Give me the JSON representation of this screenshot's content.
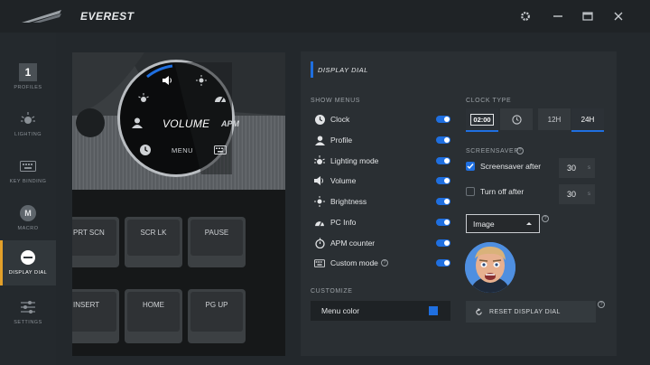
{
  "app": {
    "title": "EVEREST"
  },
  "sidebar": {
    "items": [
      {
        "label": "PROFILES",
        "badge": "1"
      },
      {
        "label": "LIGHTING"
      },
      {
        "label": "KEY BINDING"
      },
      {
        "label": "MACRO",
        "badge": "M"
      },
      {
        "label": "DISPLAY DIAL",
        "active": true
      },
      {
        "label": "SETTINGS"
      }
    ]
  },
  "preview": {
    "dial": {
      "center_label": "VOLUME",
      "apm_label": "APM",
      "menu_label": "MENU"
    },
    "keys": [
      "PRT SCN",
      "SCR LK",
      "PAUSE",
      "INSERT",
      "HOME",
      "PG UP"
    ]
  },
  "panel": {
    "title": "DISPLAY DIAL",
    "show_menus_label": "SHOW MENUS",
    "menus": [
      {
        "label": "Clock",
        "icon": "clock-icon",
        "enabled": true
      },
      {
        "label": "Profile",
        "icon": "profile-icon",
        "enabled": true
      },
      {
        "label": "Lighting mode",
        "icon": "lighting-icon",
        "enabled": true
      },
      {
        "label": "Volume",
        "icon": "volume-icon",
        "enabled": true
      },
      {
        "label": "Brightness",
        "icon": "brightness-icon",
        "enabled": true
      },
      {
        "label": "PC Info",
        "icon": "gauge-icon",
        "enabled": true
      },
      {
        "label": "APM counter",
        "icon": "stopwatch-icon",
        "enabled": true
      },
      {
        "label": "Custom mode",
        "icon": "keyboard-icon",
        "enabled": true
      }
    ],
    "customize_label": "CUSTOMIZE",
    "menu_color_label": "Menu color",
    "menu_color": "#1f6fe0",
    "clock_type_label": "CLOCK TYPE",
    "clock_digital": "02:00",
    "clock_12h": "12H",
    "clock_24h": "24H",
    "screensaver_label": "SCREENSAVER",
    "screensaver_after_label": "Screensaver after",
    "screensaver_after_value": "30",
    "screensaver_after_checked": true,
    "turn_off_after_label": "Turn off after",
    "turn_off_after_value": "30",
    "turn_off_after_checked": false,
    "unit": "s",
    "image_select": "Image",
    "reset_label": "RESET DISPLAY DIAL"
  },
  "colors": {
    "accent": "#1f6fe0",
    "active_marker": "#e3a02a"
  }
}
